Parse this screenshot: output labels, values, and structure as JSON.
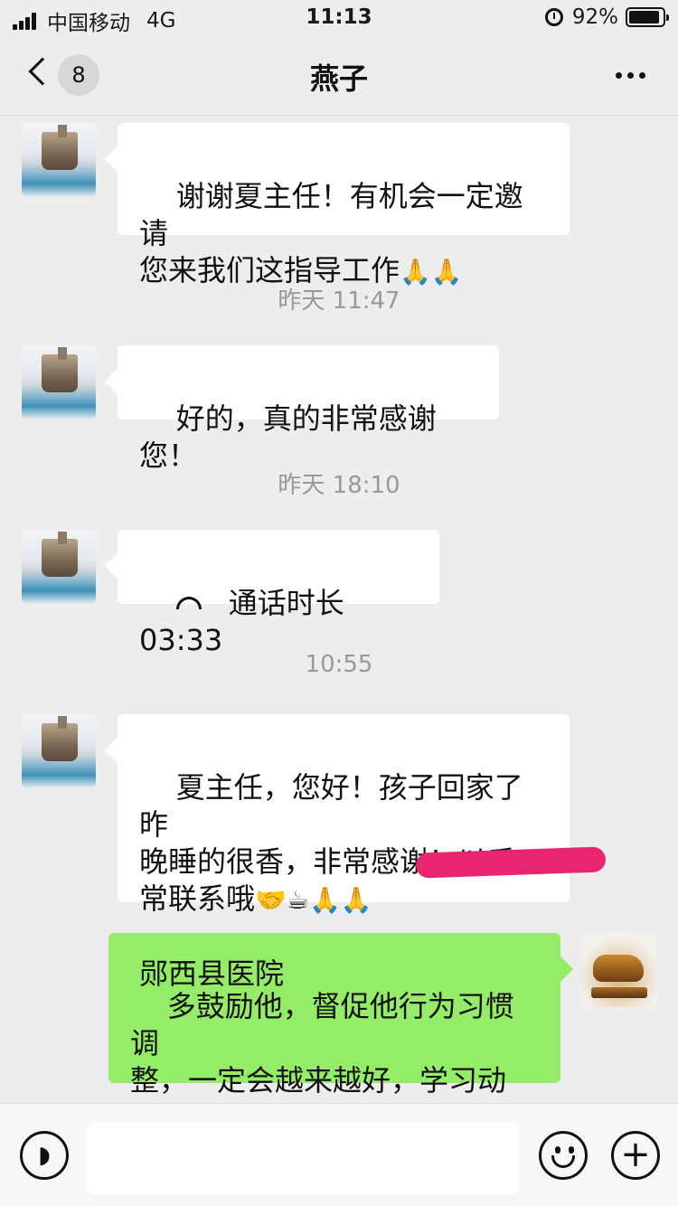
{
  "status_bar": {
    "carrier": "中国移动",
    "network": "4G",
    "time": "11:13",
    "battery_text": "92%",
    "battery_level": 0.92
  },
  "nav": {
    "unread_count": "8",
    "title": "燕子",
    "icons": {
      "back": "chevron-left-icon",
      "more": "more-dots-icon"
    }
  },
  "messages": [
    {
      "side": "in",
      "text": "谢谢夏主任！有机会一定邀请\n您来我们这指导工作",
      "emoji": "🙏🙏"
    },
    {
      "timestamp": "昨天 11:47"
    },
    {
      "side": "in",
      "text": "好的，真的非常感谢您！"
    },
    {
      "timestamp": "昨天 18:10"
    },
    {
      "side": "in",
      "call_text": "通话时长 03:33",
      "icon": "phone-hangup-icon"
    },
    {
      "timestamp": "10:55"
    },
    {
      "side": "in",
      "text": "夏主任，您好！孩子回家了昨\n晚睡的很香，非常感谢！以后\n常联系哦",
      "emoji": "🤝☕🙏🙏",
      "signature": "郧西县医院"
    },
    {
      "side": "out",
      "text": "多鼓励他，督促他行为习惯调\n整，一定会越来越好，学习动\n力也会不断增强的！",
      "emoji": "🌹🌹🌹"
    }
  ],
  "input_bar": {
    "placeholder": "",
    "icons": {
      "voice": "voice-icon",
      "emoji": "emoji-icon",
      "plus": "plus-icon"
    }
  },
  "colors": {
    "background": "#ededed",
    "incoming_bubble": "#ffffff",
    "outgoing_bubble": "#95ec69",
    "timestamp": "#999999",
    "redaction": "#e8256e"
  }
}
